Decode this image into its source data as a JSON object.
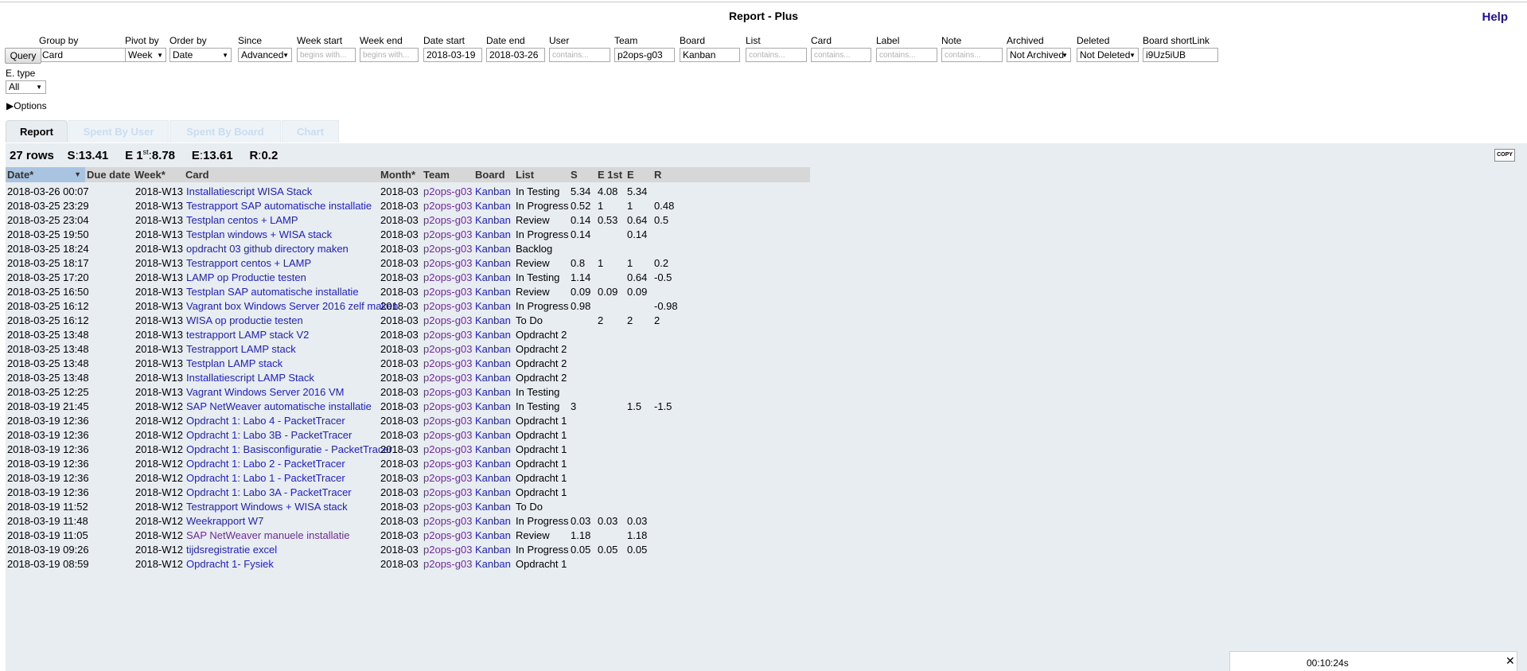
{
  "app": {
    "title": "Report - Plus",
    "help": "Help"
  },
  "query_button": "Query",
  "filters": [
    {
      "label": "Group by",
      "value": "Card",
      "kind": "select"
    },
    {
      "label": "Pivot by",
      "value": "Week",
      "kind": "select"
    },
    {
      "label": "Order by",
      "value": "Date",
      "kind": "select"
    },
    {
      "label": "Since",
      "value": "Advanced",
      "kind": "select"
    },
    {
      "label": "Week start",
      "value": "begins with...",
      "kind": "placeholder"
    },
    {
      "label": "Week end",
      "value": "begins with...",
      "kind": "placeholder"
    },
    {
      "label": "Date start",
      "value": "2018-03-19",
      "kind": "input"
    },
    {
      "label": "Date end",
      "value": "2018-03-26",
      "kind": "input"
    },
    {
      "label": "User",
      "value": "contains...",
      "kind": "placeholder"
    },
    {
      "label": "Team",
      "value": "p2ops-g03",
      "kind": "input"
    },
    {
      "label": "Board",
      "value": "Kanban",
      "kind": "input"
    },
    {
      "label": "List",
      "value": "contains...",
      "kind": "placeholder"
    },
    {
      "label": "Card",
      "value": "contains...",
      "kind": "placeholder"
    },
    {
      "label": "Label",
      "value": "contains...",
      "kind": "placeholder"
    },
    {
      "label": "Note",
      "value": "contains...",
      "kind": "placeholder"
    },
    {
      "label": "Archived",
      "value": "Not Archived",
      "kind": "select"
    },
    {
      "label": "Deleted",
      "value": "Not Deleted",
      "kind": "select"
    },
    {
      "label": "Board shortLink",
      "value": "i9Uz5iUB",
      "kind": "input"
    }
  ],
  "etype": {
    "label": "E. type",
    "value": "All"
  },
  "options_label": "Options",
  "tabs": [
    "Report",
    "Spent By User",
    "Spent By Board",
    "Chart"
  ],
  "summary": {
    "rows": "27 rows",
    "s_label": "S",
    "s": "13.41",
    "e1_label": "E 1",
    "e1_sup": "st",
    "e1": "8.78",
    "e_label": "E",
    "e": "13.61",
    "r_label": "R",
    "r": "0.2"
  },
  "copy_label": "COPY",
  "columns": [
    "Date*",
    "Due date",
    "Week*",
    "Card",
    "Month*",
    "Team",
    "Board",
    "List",
    "S",
    "E 1st",
    "E",
    "R"
  ],
  "rows": [
    [
      "2018-03-26 00:07",
      "",
      "2018-W13",
      "Installatiescript WISA Stack",
      "2018-03",
      "p2ops-g03",
      "Kanban",
      "In Testing",
      "5.34",
      "4.08",
      "5.34",
      ""
    ],
    [
      "2018-03-25 23:29",
      "",
      "2018-W13",
      "Testrapport SAP automatische installatie",
      "2018-03",
      "p2ops-g03",
      "Kanban",
      "In Progress",
      "0.52",
      "1",
      "1",
      "0.48"
    ],
    [
      "2018-03-25 23:04",
      "",
      "2018-W13",
      "Testplan centos + LAMP",
      "2018-03",
      "p2ops-g03",
      "Kanban",
      "Review",
      "0.14",
      "0.53",
      "0.64",
      "0.5"
    ],
    [
      "2018-03-25 19:50",
      "",
      "2018-W13",
      "Testplan windows + WISA stack",
      "2018-03",
      "p2ops-g03",
      "Kanban",
      "In Progress",
      "0.14",
      "",
      "0.14",
      ""
    ],
    [
      "2018-03-25 18:24",
      "",
      "2018-W13",
      "opdracht 03 github directory maken",
      "2018-03",
      "p2ops-g03",
      "Kanban",
      "Backlog",
      "",
      "",
      "",
      ""
    ],
    [
      "2018-03-25 18:17",
      "",
      "2018-W13",
      "Testrapport centos + LAMP",
      "2018-03",
      "p2ops-g03",
      "Kanban",
      "Review",
      "0.8",
      "1",
      "1",
      "0.2"
    ],
    [
      "2018-03-25 17:20",
      "",
      "2018-W13",
      "LAMP op Productie testen",
      "2018-03",
      "p2ops-g03",
      "Kanban",
      "In Testing",
      "1.14",
      "",
      "0.64",
      "-0.5"
    ],
    [
      "2018-03-25 16:50",
      "",
      "2018-W13",
      "Testplan SAP automatische installatie",
      "2018-03",
      "p2ops-g03",
      "Kanban",
      "Review",
      "0.09",
      "0.09",
      "0.09",
      ""
    ],
    [
      "2018-03-25 16:12",
      "",
      "2018-W13",
      "Vagrant box Windows Server 2016 zelf maken",
      "2018-03",
      "p2ops-g03",
      "Kanban",
      "In Progress",
      "0.98",
      "",
      "",
      "-0.98"
    ],
    [
      "2018-03-25 16:12",
      "",
      "2018-W13",
      "WISA op productie testen",
      "2018-03",
      "p2ops-g03",
      "Kanban",
      "To Do",
      "",
      "2",
      "2",
      "2"
    ],
    [
      "2018-03-25 13:48",
      "",
      "2018-W13",
      "testrapport LAMP stack V2",
      "2018-03",
      "p2ops-g03",
      "Kanban",
      "Opdracht 2",
      "",
      "",
      "",
      ""
    ],
    [
      "2018-03-25 13:48",
      "",
      "2018-W13",
      "Testrapport LAMP stack",
      "2018-03",
      "p2ops-g03",
      "Kanban",
      "Opdracht 2",
      "",
      "",
      "",
      ""
    ],
    [
      "2018-03-25 13:48",
      "",
      "2018-W13",
      "Testplan LAMP stack",
      "2018-03",
      "p2ops-g03",
      "Kanban",
      "Opdracht 2",
      "",
      "",
      "",
      ""
    ],
    [
      "2018-03-25 13:48",
      "",
      "2018-W13",
      "Installatiescript LAMP Stack",
      "2018-03",
      "p2ops-g03",
      "Kanban",
      "Opdracht 2",
      "",
      "",
      "",
      ""
    ],
    [
      "2018-03-25 12:25",
      "",
      "2018-W13",
      "Vagrant Windows Server 2016 VM",
      "2018-03",
      "p2ops-g03",
      "Kanban",
      "In Testing",
      "",
      "",
      "",
      ""
    ],
    [
      "2018-03-19 21:45",
      "",
      "2018-W12",
      "SAP NetWeaver automatische installatie",
      "2018-03",
      "p2ops-g03",
      "Kanban",
      "In Testing",
      "3",
      "",
      "1.5",
      "-1.5"
    ],
    [
      "2018-03-19 12:36",
      "",
      "2018-W12",
      "Opdracht 1: Labo 4 - PacketTracer",
      "2018-03",
      "p2ops-g03",
      "Kanban",
      "Opdracht 1",
      "",
      "",
      "",
      ""
    ],
    [
      "2018-03-19 12:36",
      "",
      "2018-W12",
      "Opdracht 1: Labo 3B - PacketTracer",
      "2018-03",
      "p2ops-g03",
      "Kanban",
      "Opdracht 1",
      "",
      "",
      "",
      ""
    ],
    [
      "2018-03-19 12:36",
      "",
      "2018-W12",
      "Opdracht 1: Basisconfiguratie - PacketTracer",
      "2018-03",
      "p2ops-g03",
      "Kanban",
      "Opdracht 1",
      "",
      "",
      "",
      ""
    ],
    [
      "2018-03-19 12:36",
      "",
      "2018-W12",
      "Opdracht 1: Labo 2 - PacketTracer",
      "2018-03",
      "p2ops-g03",
      "Kanban",
      "Opdracht 1",
      "",
      "",
      "",
      ""
    ],
    [
      "2018-03-19 12:36",
      "",
      "2018-W12",
      "Opdracht 1: Labo 1 - PacketTracer",
      "2018-03",
      "p2ops-g03",
      "Kanban",
      "Opdracht 1",
      "",
      "",
      "",
      ""
    ],
    [
      "2018-03-19 12:36",
      "",
      "2018-W12",
      "Opdracht 1: Labo 3A - PacketTracer",
      "2018-03",
      "p2ops-g03",
      "Kanban",
      "Opdracht 1",
      "",
      "",
      "",
      ""
    ],
    [
      "2018-03-19 11:52",
      "",
      "2018-W12",
      "Testrapport Windows + WISA stack",
      "2018-03",
      "p2ops-g03",
      "Kanban",
      "To Do",
      "",
      "",
      "",
      ""
    ],
    [
      "2018-03-19 11:48",
      "",
      "2018-W12",
      "Weekrapport W7",
      "2018-03",
      "p2ops-g03",
      "Kanban",
      "In Progress",
      "0.03",
      "0.03",
      "0.03",
      ""
    ],
    [
      "2018-03-19 11:05",
      "",
      "2018-W12",
      "SAP NetWeaver manuele installatie",
      "2018-03",
      "p2ops-g03",
      "Kanban",
      "Review",
      "1.18",
      "",
      "1.18",
      ""
    ],
    [
      "2018-03-19 09:26",
      "",
      "2018-W12",
      "tijdsregistratie excel",
      "2018-03",
      "p2ops-g03",
      "Kanban",
      "In Progress",
      "0.05",
      "0.05",
      "0.05",
      ""
    ],
    [
      "2018-03-19 08:59",
      "",
      "2018-W12",
      "Opdracht 1- Fysiek",
      "2018-03",
      "p2ops-g03",
      "Kanban",
      "Opdracht 1",
      "",
      "",
      "",
      ""
    ]
  ],
  "visited_cards": [
    24
  ],
  "timer": {
    "time": "00:10:24s",
    "close": "✕"
  },
  "colors": {
    "link": "#2020c8",
    "visited": "#6d2c9c",
    "panel": "#e8edf2",
    "header": "#d7d7d7",
    "sorted": "#a8c4e0"
  }
}
